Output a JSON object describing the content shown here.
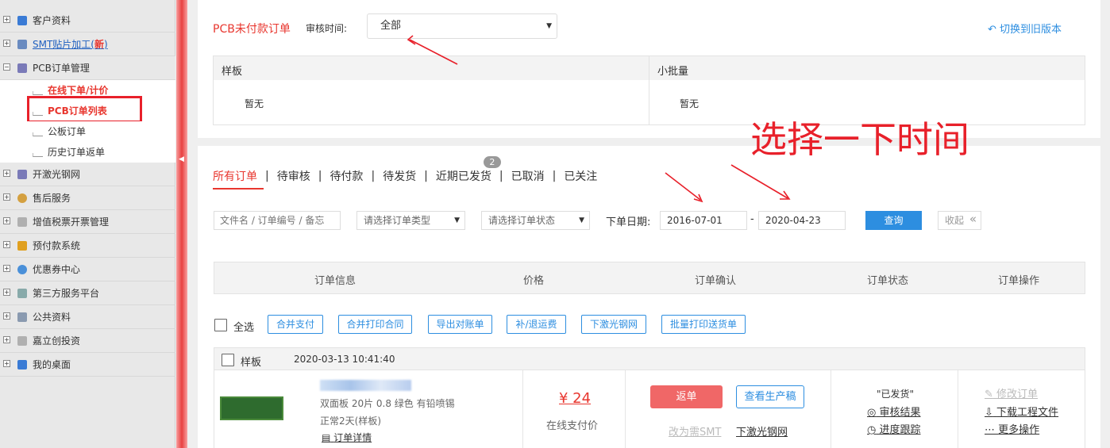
{
  "sidebar": {
    "items": [
      {
        "label": "客户资料",
        "icon": "user-icon"
      },
      {
        "label": "SMT贴片加工(",
        "badge": "新",
        "close": ")",
        "icon": "chip-icon"
      },
      {
        "label": "PCB订单管理",
        "icon": "doc-icon",
        "expanded": true
      },
      {
        "label": "开激光钢网",
        "icon": "doc-icon"
      },
      {
        "label": "售后服务",
        "icon": "people-icon"
      },
      {
        "label": "增值税票开票管理",
        "icon": "invoice-icon"
      },
      {
        "label": "预付款系统",
        "icon": "money-icon"
      },
      {
        "label": "优惠券中心",
        "icon": "coupon-icon"
      },
      {
        "label": "第三方服务平台",
        "icon": "platform-icon"
      },
      {
        "label": "公共资料",
        "icon": "folder-icon"
      },
      {
        "label": "嘉立创投资",
        "icon": "invest-icon"
      },
      {
        "label": "我的桌面",
        "icon": "desktop-icon"
      }
    ],
    "sub": [
      {
        "label": "在线下单/计价"
      },
      {
        "label": "PCB订单列表"
      },
      {
        "label": "公板订单"
      },
      {
        "label": "历史订单返单"
      }
    ]
  },
  "top": {
    "title": "PCB未付款订单",
    "review_label": "审核时间:",
    "review_value": "全部",
    "switch_label": "切换到旧版本",
    "cols": [
      {
        "head": "样板",
        "body": "暂无"
      },
      {
        "head": "小批量",
        "body": "暂无"
      }
    ]
  },
  "annotation": "选择一下时间",
  "tabs": [
    {
      "label": "所有订单",
      "active": true
    },
    {
      "label": "待审核"
    },
    {
      "label": "待付款"
    },
    {
      "label": "待发货"
    },
    {
      "label": "近期已发货",
      "badge": "2"
    },
    {
      "label": "已取消"
    },
    {
      "label": "已关注"
    }
  ],
  "filters": {
    "search_placeholder": "文件名 / 订单编号 / 备忘",
    "type_placeholder": "请选择订单类型",
    "status_placeholder": "请选择订单状态",
    "date_label": "下单日期:",
    "date_from": "2016-07-01",
    "date_sep": "-",
    "date_to": "2020-04-23",
    "query": "查询",
    "collapse": "收起"
  },
  "table": {
    "headers": [
      "订单信息",
      "价格",
      "订单确认",
      "订单状态",
      "订单操作"
    ]
  },
  "bulk": {
    "select_all": "全选",
    "actions": [
      "合并支付",
      "合并打印合同",
      "导出对账单",
      "补/退运费",
      "下激光钢网",
      "批量打印送货单"
    ]
  },
  "order": {
    "type": "样板",
    "time": "2020-03-13 10:41:40",
    "specs": "双面板  20片  0.8  绿色  有铅喷锡",
    "delivery": "正常2天(样板)",
    "detail": "订单详情",
    "price": "¥ 24",
    "pay_note": "在线支付价",
    "return_btn": "返单",
    "view_btn": "查看生产稿",
    "to_smt": "改为需SMT",
    "stencil": "下激光钢网",
    "status": "\"已发货\"",
    "review_result": "审核结果",
    "progress": "进度跟踪",
    "ops": [
      "修改订单",
      "下载工程文件",
      "更多操作"
    ]
  },
  "colors": {
    "red": "#e8362e",
    "blue": "#2d8ee0",
    "annot": "#e8202a"
  }
}
